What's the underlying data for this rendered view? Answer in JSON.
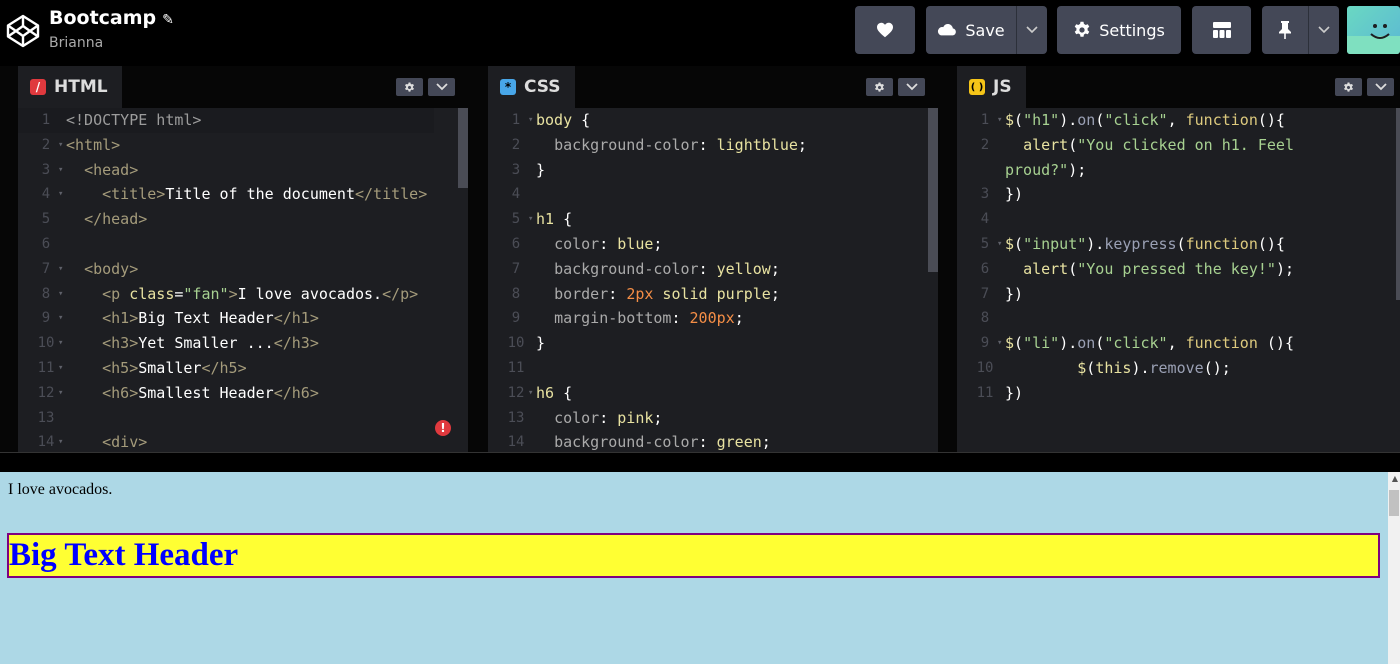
{
  "header": {
    "title": "Bootcamp",
    "owner": "Brianna",
    "save_label": "Save",
    "settings_label": "Settings"
  },
  "editors": {
    "html": {
      "name": "HTML",
      "icon": "/",
      "icon_color": "#e0393e",
      "lines": [
        {
          "n": "1",
          "fold": false,
          "html": "<span class='c-doc'>&lt;!DOCTYPE html&gt;</span>"
        },
        {
          "n": "2",
          "fold": true,
          "html": "<span class='c-tag'>&lt;html&gt;</span>"
        },
        {
          "n": "3",
          "fold": true,
          "html": "  <span class='c-tag'>&lt;head&gt;</span>"
        },
        {
          "n": "4",
          "fold": true,
          "html": "    <span class='c-tag'>&lt;title&gt;</span><span class='c-plain'>Title of the document</span><span class='c-tag'>&lt;/title&gt;</span>"
        },
        {
          "n": "5",
          "fold": false,
          "html": "  <span class='c-tag'>&lt;/head&gt;</span>"
        },
        {
          "n": "6",
          "fold": false,
          "html": ""
        },
        {
          "n": "7",
          "fold": true,
          "html": "  <span class='c-tag'>&lt;body&gt;</span>"
        },
        {
          "n": "8",
          "fold": true,
          "html": "    <span class='c-tag'>&lt;p </span><span class='c-attr'>class</span><span class='c-plain'>=</span><span class='c-str'>\"fan\"</span><span class='c-tag'>&gt;</span><span class='c-plain'>I love avocados.</span><span class='c-tag'>&lt;/p&gt;</span>"
        },
        {
          "n": "9",
          "fold": true,
          "html": "    <span class='c-tag'>&lt;h1&gt;</span><span class='c-plain'>Big Text Header</span><span class='c-tag'>&lt;/h1&gt;</span>"
        },
        {
          "n": "10",
          "fold": true,
          "html": "    <span class='c-tag'>&lt;h3&gt;</span><span class='c-plain'>Yet Smaller ...</span><span class='c-tag'>&lt;/h3&gt;</span>"
        },
        {
          "n": "11",
          "fold": true,
          "html": "    <span class='c-tag'>&lt;h5&gt;</span><span class='c-plain'>Smaller</span><span class='c-tag'>&lt;/h5&gt;</span>"
        },
        {
          "n": "12",
          "fold": true,
          "html": "    <span class='c-tag'>&lt;h6&gt;</span><span class='c-plain'>Smallest Header</span><span class='c-tag'>&lt;/h6&gt;</span>"
        },
        {
          "n": "13",
          "fold": false,
          "html": ""
        },
        {
          "n": "14",
          "fold": true,
          "html": "    <span class='c-tag'>&lt;div&gt;</span>"
        }
      ]
    },
    "css": {
      "name": "CSS",
      "icon": "*",
      "icon_color": "#48a6e8",
      "lines": [
        {
          "n": "1",
          "fold": true,
          "html": "<span class='c-sel'>body</span><span class='c-plain'> {</span>"
        },
        {
          "n": "2",
          "fold": false,
          "html": "  <span class='c-prop'>background-color</span><span class='c-plain'>: </span><span class='c-val'>lightblue</span><span class='c-plain'>;</span>"
        },
        {
          "n": "3",
          "fold": false,
          "html": "<span class='c-plain'>}</span>"
        },
        {
          "n": "4",
          "fold": false,
          "html": ""
        },
        {
          "n": "5",
          "fold": true,
          "html": "<span class='c-sel'>h1</span><span class='c-plain'> {</span>"
        },
        {
          "n": "6",
          "fold": false,
          "html": "  <span class='c-prop'>color</span><span class='c-plain'>: </span><span class='c-val'>blue</span><span class='c-plain'>;</span>"
        },
        {
          "n": "7",
          "fold": false,
          "html": "  <span class='c-prop'>background-color</span><span class='c-plain'>: </span><span class='c-val'>yellow</span><span class='c-plain'>;</span>"
        },
        {
          "n": "8",
          "fold": false,
          "html": "  <span class='c-prop'>border</span><span class='c-plain'>: </span><span class='c-num'>2px</span><span class='c-val'> solid purple</span><span class='c-plain'>;</span>"
        },
        {
          "n": "9",
          "fold": false,
          "html": "  <span class='c-prop'>margin-bottom</span><span class='c-plain'>: </span><span class='c-num'>200px</span><span class='c-plain'>;</span>"
        },
        {
          "n": "10",
          "fold": false,
          "html": "<span class='c-plain'>}</span>"
        },
        {
          "n": "11",
          "fold": false,
          "html": ""
        },
        {
          "n": "12",
          "fold": true,
          "html": "<span class='c-sel'>h6</span><span class='c-plain'> {</span>"
        },
        {
          "n": "13",
          "fold": false,
          "html": "  <span class='c-prop'>color</span><span class='c-plain'>: </span><span class='c-val'>pink</span><span class='c-plain'>;</span>"
        },
        {
          "n": "14",
          "fold": false,
          "html": "  <span class='c-prop'>background-color</span><span class='c-plain'>: </span><span class='c-val'>green</span><span class='c-plain'>;</span>"
        }
      ]
    },
    "js": {
      "name": "JS",
      "icon": "( )",
      "icon_color": "#f5c518",
      "lines": [
        {
          "n": "1",
          "fold": true,
          "html": "<span class='c-fn'>$</span><span class='c-plain'>(</span><span class='c-jsstr'>\"h1\"</span><span class='c-plain'>).</span><span class='c-meth'>on</span><span class='c-plain'>(</span><span class='c-jsstr'>\"click\"</span><span class='c-plain'>, </span><span class='c-kw'>function</span><span class='c-plain'>(){</span>"
        },
        {
          "n": "2",
          "fold": false,
          "html": "  <span class='c-fn'>alert</span><span class='c-plain'>(</span><span class='c-jsstr'>\"You clicked on h1. Feel</span>"
        },
        {
          "n": "",
          "fold": false,
          "html": "<span class='c-jsstr'>proud?\"</span><span class='c-plain'>);</span>"
        },
        {
          "n": "3",
          "fold": false,
          "html": "<span class='c-plain'>})</span>"
        },
        {
          "n": "4",
          "fold": false,
          "html": ""
        },
        {
          "n": "5",
          "fold": true,
          "html": "<span class='c-fn'>$</span><span class='c-plain'>(</span><span class='c-jsstr'>\"input\"</span><span class='c-plain'>).</span><span class='c-meth'>keypress</span><span class='c-plain'>(</span><span class='c-kw'>function</span><span class='c-plain'>(){</span>"
        },
        {
          "n": "6",
          "fold": false,
          "html": "  <span class='c-fn'>alert</span><span class='c-plain'>(</span><span class='c-jsstr'>\"You pressed the key!\"</span><span class='c-plain'>);</span>"
        },
        {
          "n": "7",
          "fold": false,
          "html": "<span class='c-plain'>})</span>"
        },
        {
          "n": "8",
          "fold": false,
          "html": ""
        },
        {
          "n": "9",
          "fold": true,
          "html": "<span class='c-fn'>$</span><span class='c-plain'>(</span><span class='c-jsstr'>\"li\"</span><span class='c-plain'>).</span><span class='c-meth'>on</span><span class='c-plain'>(</span><span class='c-jsstr'>\"click\"</span><span class='c-plain'>, </span><span class='c-kw'>function</span><span class='c-plain'> (){</span>"
        },
        {
          "n": "10",
          "fold": false,
          "html": "        <span class='c-fn'>$</span><span class='c-plain'>(</span><span class='c-fn'>this</span><span class='c-plain'>).</span><span class='c-meth'>remove</span><span class='c-plain'>();</span>"
        },
        {
          "n": "11",
          "fold": false,
          "html": "<span class='c-plain'>})</span>"
        }
      ]
    }
  },
  "preview": {
    "p_text": "I love avocados.",
    "h1_text": "Big Text Header"
  },
  "colors": {
    "toolbar_button": "#444857",
    "editor_bg": "#1d1e22",
    "preview_bg": "#add8e6",
    "h1_bg": "#ffff33"
  }
}
